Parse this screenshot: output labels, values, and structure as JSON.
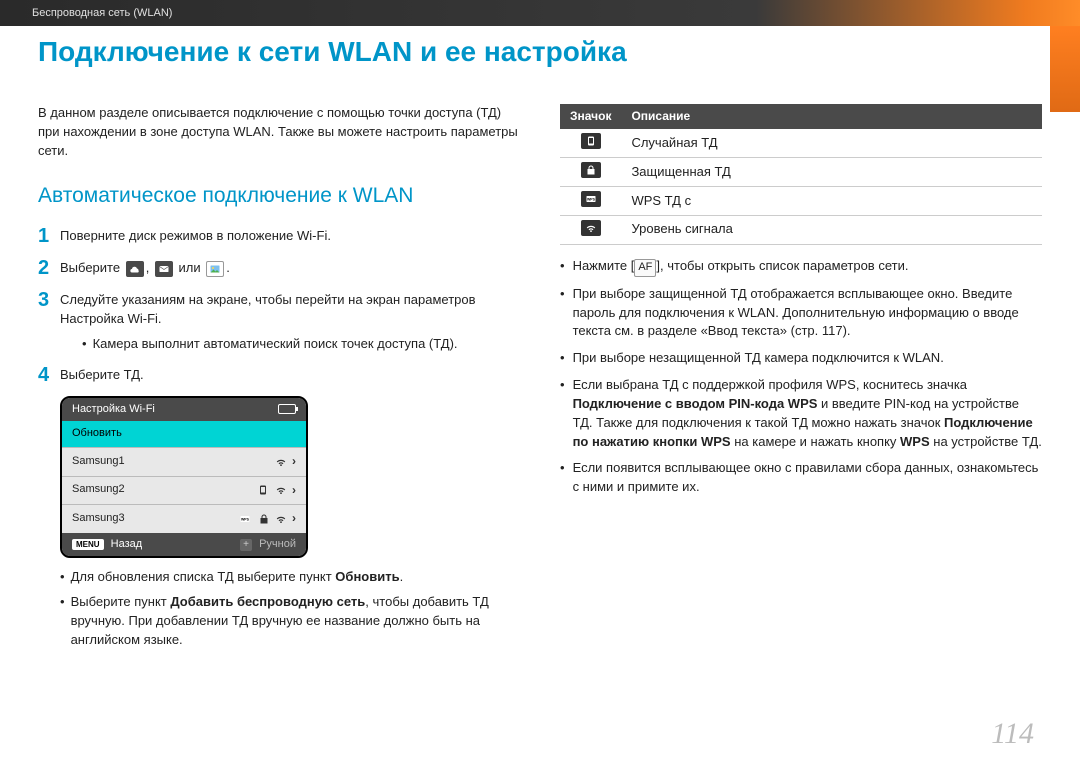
{
  "topbar": {
    "breadcrumb": "Беспроводная сеть (WLAN)"
  },
  "title": "Подключение к сети WLAN и ее настройка",
  "left": {
    "intro": "В данном разделе описывается подключение с помощью точки доступа (ТД) при нахождении в зоне доступа WLAN. Также вы можете настроить параметры сети.",
    "subhead": "Автоматическое подключение к WLAN",
    "step1_a": "Поверните диск режимов в положение ",
    "step1_b": ".",
    "wifi_word": "Wi-Fi",
    "step2_a": "Выберите ",
    "step2_b": ", ",
    "step2_c": " или ",
    "step2_d": ".",
    "step3": "Следуйте указаниям на экране, чтобы перейти на экран параметров Настройка Wi-Fi.",
    "step3_sub": "Камера выполнит автоматический поиск точек доступа (ТД).",
    "step4": "Выберите ТД.",
    "wifi_widget": {
      "title": "Настройка Wi-Fi",
      "rows": [
        "Обновить",
        "Samsung1",
        "Samsung2",
        "Samsung3"
      ],
      "footer_back": "Назад",
      "footer_manual": "Ручной",
      "menu_label": "MENU"
    },
    "after1_a": "Для обновления списка ТД выберите пункт ",
    "after1_b": "Обновить",
    "after1_c": ".",
    "after2_a": "Выберите пункт ",
    "after2_b": "Добавить беспроводную сеть",
    "after2_c": ", чтобы добавить ТД вручную. При добавлении ТД вручную ее название должно быть на английском языке."
  },
  "right": {
    "th_icon": "Значок",
    "th_desc": "Описание",
    "rows": [
      {
        "desc": "Случайная ТД"
      },
      {
        "desc": "Защищенная ТД"
      },
      {
        "desc": "WPS ТД с"
      },
      {
        "desc": "Уровень сигнала"
      }
    ],
    "b1_a": "Нажмите [",
    "b1_key": "AF",
    "b1_b": "], чтобы открыть список параметров сети.",
    "b2": "При выборе защищенной ТД отображается всплывающее окно. Введите пароль для подключения к WLAN. Дополнительную информацию о вводе текста см. в разделе «Ввод текста» (стр. 117).",
    "b3": "При выборе незащищенной ТД камера подключится к WLAN.",
    "b4_a": "Если выбрана ТД с поддержкой профиля WPS, коснитесь значка ",
    "b4_b": "Подключение с вводом PIN-кода WPS",
    "b4_c": " и введите PIN-код на устройстве ТД. Также для подключения к такой ТД можно нажать значок ",
    "b4_d": "Подключение по нажатию кнопки WPS",
    "b4_e": " на камере и нажать кнопку ",
    "b4_f": "WPS",
    "b4_g": " на устройстве ТД.",
    "b5": "Если появится всплывающее окно с правилами сбора данных, ознакомьтесь с ними и примите их."
  },
  "page_number": "114"
}
